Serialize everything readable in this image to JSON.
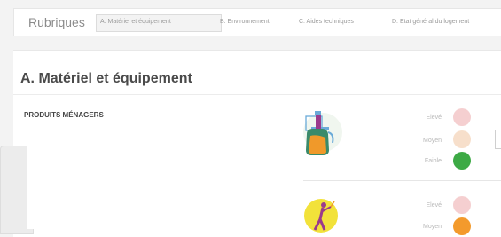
{
  "header": {
    "title": "Rubriques",
    "tabs": [
      {
        "label": "A. Matériel et équipement",
        "active": true
      },
      {
        "label": "B. Environnement",
        "active": false
      },
      {
        "label": "C. Aides techniques",
        "active": false
      },
      {
        "label": "D. Etat général du logement",
        "active": false
      }
    ]
  },
  "section": {
    "title": "A. Matériel et équipement",
    "product_heading": "PRODUITS MÉNAGERS",
    "rows": [
      {
        "levels": [
          {
            "label": "Elevé",
            "color": "#f5cfd0"
          },
          {
            "label": "Moyen",
            "color": "#f7dfcb"
          },
          {
            "label": "Faible",
            "color": "#3daa45"
          }
        ]
      },
      {
        "levels": [
          {
            "label": "Elevé",
            "color": "#f5cfd0"
          },
          {
            "label": "Moyen",
            "color": "#f39a2c"
          }
        ]
      }
    ]
  },
  "colors": {
    "background": "#f3f3f3",
    "panel": "#ffffff",
    "text_muted": "#9a9a9a",
    "illustration_yellow": "#f2e23a",
    "illustration_orange": "#f0992a",
    "illustration_purple": "#9b3a8c",
    "illustration_blue": "#6aaad8"
  },
  "icons": {
    "row1": "cleaning-product-spray-bottle-icon",
    "row2": "person-cleaning-icon"
  }
}
